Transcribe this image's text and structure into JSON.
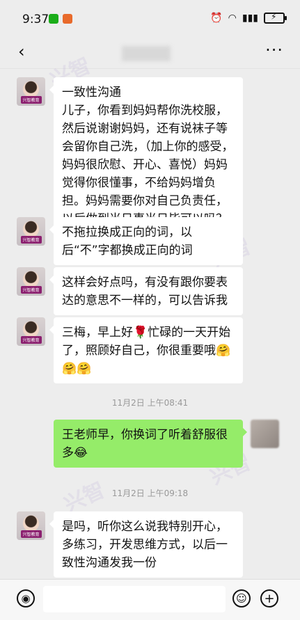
{
  "status_bar": {
    "time": "9:37",
    "right_icons": [
      "alarm-icon",
      "wifi-icon",
      "signal-icon",
      "battery-icon"
    ]
  },
  "nav": {
    "back_icon": "chevron-left-icon",
    "more_icon": "more-icon",
    "more_text": "···"
  },
  "watermarks": [
    "兴智",
    "兴智",
    "兴智",
    "兴智"
  ],
  "messages": [
    {
      "from": "them",
      "lines": [
        "一致性沟通",
        "儿子，你看到妈妈帮你洗校服，然后说谢谢妈妈，还有说袜子等会留你自己洗，（加上你的感受，妈妈很欣慰、开心、喜悦）妈妈觉得你很懂事，不给妈妈增负担。妈妈需要你对自己负责任，以后做到当日事当日毕可以吗？"
      ]
    },
    {
      "from": "them",
      "text": "不拖拉换成正向的词，以后“不”字都换成正向的词"
    },
    {
      "from": "them",
      "text": "这样会好点吗，有没有跟你要表达的意思不一样的，可以告诉我"
    },
    {
      "from": "them",
      "text": "三梅，早上好🌹忙碌的一天开始了，照顾好自己，你很重要哦🤗🤗🤗"
    },
    {
      "timestamp": "11月2日 上午08:41"
    },
    {
      "from": "me",
      "text": "王老师早，你换词了听着舒服很多😂"
    },
    {
      "timestamp": "11月2日 上午09:18"
    },
    {
      "from": "them",
      "text": "是吗，听你这么说我特别开心，多练习，开发思维方式，以后一致性沟通发我一份"
    }
  ],
  "avatar_badge": "兴智教育",
  "input_bar": {
    "voice_icon": "voice-icon",
    "emoji_icon": "emoji-icon",
    "plus_icon": "plus-icon"
  },
  "colors": {
    "background": "#ededed",
    "me_bubble": "#95ec69",
    "them_bubble": "#ffffff"
  }
}
